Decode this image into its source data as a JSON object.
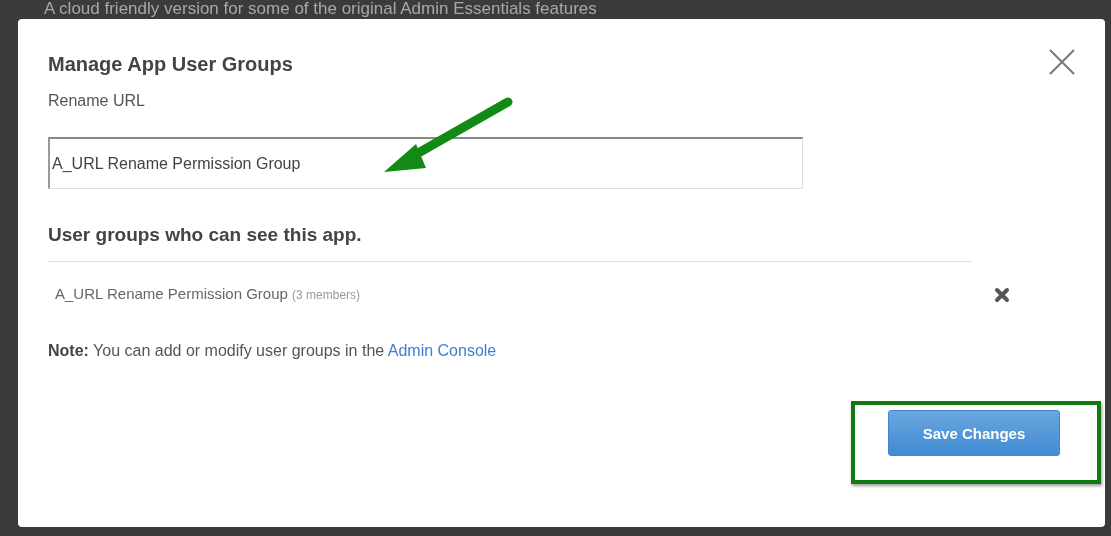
{
  "background": {
    "text": "A cloud friendly version for some of the original Admin Essentials features"
  },
  "dialog": {
    "title": "Manage App User Groups",
    "field_label": "Rename URL",
    "field": {
      "value": "A_URL Rename Permission Group"
    },
    "section_heading": "User groups who can see this app.",
    "groups": [
      {
        "name": "A_URL Rename Permission Group",
        "members": "(3 members)"
      }
    ],
    "note": {
      "text": "**Note:** You can add or modify user groups in the",
      "link": "Admin Console"
    },
    "buttons": [
      {
        "label": "Save Changes"
      }
    ]
  },
  "annotations": {
    "arrow_to_field": true,
    "frame_around_save": true
  }
}
